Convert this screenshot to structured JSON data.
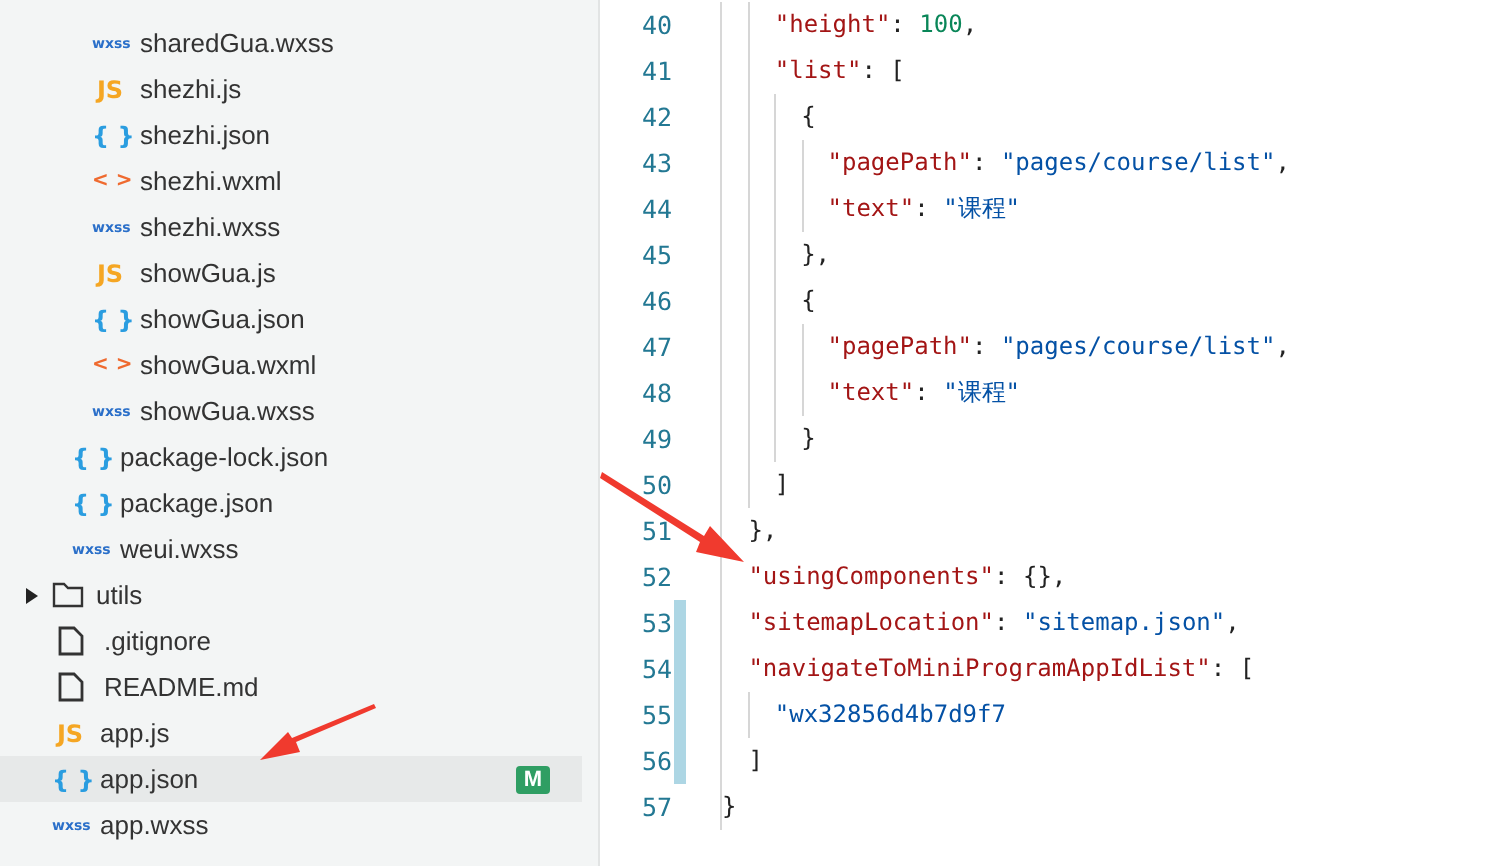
{
  "sidebar": {
    "tree": [
      {
        "children": [
          {
            "children": [
              {
                "label": "sharedGua.wxss",
                "icon": {
                  "kind": "wxss",
                  "glyph": "wxss"
                },
                "selected": false
              },
              {
                "label": "shezhi.js",
                "icon": {
                  "kind": "js",
                  "glyph": "JS"
                },
                "selected": false
              },
              {
                "label": "shezhi.json",
                "icon": {
                  "kind": "json",
                  "glyph": "{ }"
                },
                "selected": false
              },
              {
                "label": "shezhi.wxml",
                "icon": {
                  "kind": "wxml",
                  "glyph": "< >"
                },
                "selected": false
              },
              {
                "label": "shezhi.wxss",
                "icon": {
                  "kind": "wxss",
                  "glyph": "wxss"
                },
                "selected": false
              },
              {
                "label": "showGua.js",
                "icon": {
                  "kind": "js",
                  "glyph": "JS"
                },
                "selected": false
              },
              {
                "label": "showGua.json",
                "icon": {
                  "kind": "json",
                  "glyph": "{ }"
                },
                "selected": false
              },
              {
                "label": "showGua.wxml",
                "icon": {
                  "kind": "wxml",
                  "glyph": "< >"
                },
                "selected": false
              },
              {
                "label": "showGua.wxss",
                "icon": {
                  "kind": "wxss",
                  "glyph": "wxss"
                },
                "selected": false
              }
            ]
          },
          {
            "label": "package-lock.json",
            "icon": {
              "kind": "json",
              "glyph": "{ }"
            },
            "selected": false
          },
          {
            "label": "package.json",
            "icon": {
              "kind": "json",
              "glyph": "{ }"
            },
            "selected": false
          },
          {
            "label": "weui.wxss",
            "icon": {
              "kind": "wxss",
              "glyph": "wxss"
            },
            "selected": false
          }
        ]
      },
      {
        "label": "utils",
        "icon": {
          "kind": "folder"
        },
        "expanded": false,
        "selected": false
      },
      {
        "label": ".gitignore",
        "icon": {
          "kind": "file"
        },
        "selected": false
      },
      {
        "label": "README.md",
        "icon": {
          "kind": "file"
        },
        "selected": false
      },
      {
        "label": "app.js",
        "icon": {
          "kind": "js",
          "glyph": "JS"
        },
        "selected": false
      },
      {
        "label": "app.json",
        "icon": {
          "kind": "json",
          "glyph": "{ }"
        },
        "selected": true,
        "badge": "M"
      },
      {
        "label": "app.wxss",
        "icon": {
          "kind": "wxss",
          "glyph": "wxss"
        },
        "selected": false
      }
    ]
  },
  "editor": {
    "lines": [
      {
        "number": "40",
        "modified": false,
        "tokens": [
          {
            "kind": "key",
            "text": "\"height\""
          },
          {
            "kind": "punct",
            "text": ": "
          },
          {
            "kind": "number",
            "text": "100"
          },
          {
            "kind": "punct",
            "text": ","
          }
        ]
      },
      {
        "number": "41",
        "modified": false,
        "tokens": [
          {
            "kind": "key",
            "text": "\"list\""
          },
          {
            "kind": "punct",
            "text": ": ["
          }
        ]
      },
      {
        "number": "42",
        "modified": false,
        "tokens": [
          {
            "kind": "punct",
            "text": "{"
          }
        ]
      },
      {
        "number": "43",
        "modified": false,
        "tokens": [
          {
            "kind": "key",
            "text": "\"pagePath\""
          },
          {
            "kind": "punct",
            "text": ": "
          },
          {
            "kind": "string",
            "text": "\"pages/course/list\""
          },
          {
            "kind": "punct",
            "text": ","
          }
        ]
      },
      {
        "number": "44",
        "modified": false,
        "tokens": [
          {
            "kind": "key",
            "text": "\"text\""
          },
          {
            "kind": "punct",
            "text": ": "
          },
          {
            "kind": "string",
            "text": "\"课程\""
          }
        ]
      },
      {
        "number": "45",
        "modified": false,
        "tokens": [
          {
            "kind": "punct",
            "text": "},"
          }
        ]
      },
      {
        "number": "46",
        "modified": false,
        "tokens": [
          {
            "kind": "punct",
            "text": "{"
          }
        ]
      },
      {
        "number": "47",
        "modified": false,
        "tokens": [
          {
            "kind": "key",
            "text": "\"pagePath\""
          },
          {
            "kind": "punct",
            "text": ": "
          },
          {
            "kind": "string",
            "text": "\"pages/course/list\""
          },
          {
            "kind": "punct",
            "text": ","
          }
        ]
      },
      {
        "number": "48",
        "modified": false,
        "tokens": [
          {
            "kind": "key",
            "text": "\"text\""
          },
          {
            "kind": "punct",
            "text": ": "
          },
          {
            "kind": "string",
            "text": "\"课程\""
          }
        ]
      },
      {
        "number": "49",
        "modified": false,
        "tokens": [
          {
            "kind": "punct",
            "text": "}"
          }
        ]
      },
      {
        "number": "50",
        "modified": false,
        "tokens": [
          {
            "kind": "punct",
            "text": "]"
          }
        ]
      },
      {
        "number": "51",
        "modified": false,
        "tokens": [
          {
            "kind": "punct",
            "text": "},"
          }
        ]
      },
      {
        "number": "52",
        "modified": false,
        "tokens": [
          {
            "kind": "key",
            "text": "\"usingComponents\""
          },
          {
            "kind": "punct",
            "text": ": {},"
          }
        ]
      },
      {
        "number": "53",
        "modified": true,
        "tokens": [
          {
            "kind": "key",
            "text": "\"sitemapLocation\""
          },
          {
            "kind": "punct",
            "text": ": "
          },
          {
            "kind": "string",
            "text": "\"sitemap.json\""
          },
          {
            "kind": "punct",
            "text": ","
          }
        ]
      },
      {
        "number": "54",
        "modified": true,
        "tokens": [
          {
            "kind": "key",
            "text": "\"navigateToMiniProgramAppIdList\""
          },
          {
            "kind": "punct",
            "text": ": ["
          }
        ]
      },
      {
        "number": "55",
        "modified": true,
        "tokens": [
          {
            "kind": "string",
            "text": "\"wx32856d4b7d9f7"
          }
        ]
      },
      {
        "number": "56",
        "modified": true,
        "tokens": [
          {
            "kind": "punct",
            "text": "]"
          }
        ]
      },
      {
        "number": "57",
        "modified": false,
        "tokens": [
          {
            "kind": "punct",
            "text": "}"
          }
        ]
      }
    ]
  }
}
